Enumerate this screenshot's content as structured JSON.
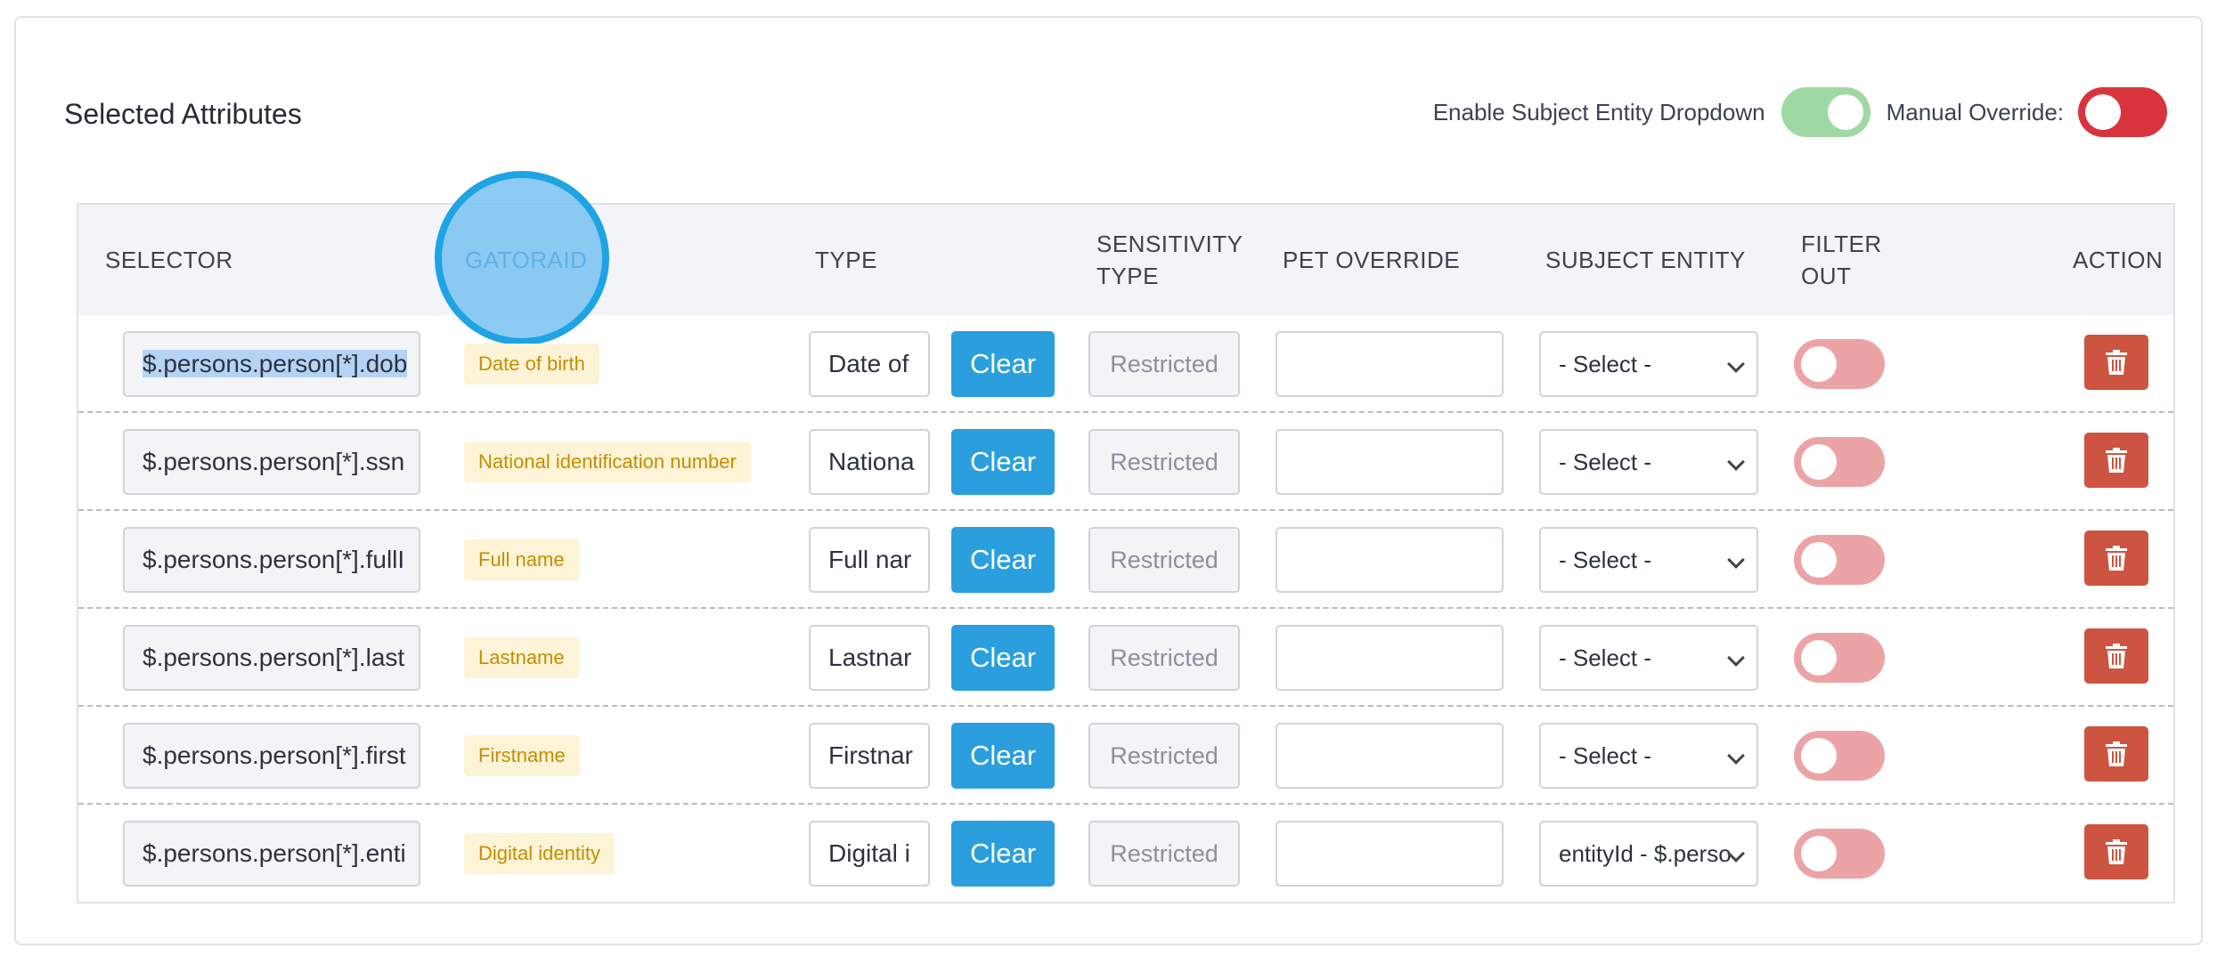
{
  "card": {
    "title": "Selected Attributes",
    "enable_subject_entity_label": "Enable Subject Entity Dropdown",
    "enable_subject_entity_on": true,
    "manual_override_label": "Manual Override:",
    "manual_override_on": false
  },
  "table": {
    "headers": {
      "selector": "SELECTOR",
      "gatoraid": "GATORAID",
      "type": "TYPE",
      "sensitivity_line1": "SENSITIVITY",
      "sensitivity_line2": "TYPE",
      "pet_override": "PET OVERRIDE",
      "subject_entity": "SUBJECT ENTITY",
      "filter_line1": "FILTER",
      "filter_line2": "OUT",
      "action": "ACTION"
    },
    "rows": [
      {
        "selector": "$.persons.person[*].dob",
        "gatoraid": "Date of birth",
        "type": "Date of",
        "clear": "Clear",
        "sensitivity": "Restricted",
        "pet_override": "",
        "subject_entity": "- Select -",
        "filter_out": false
      },
      {
        "selector": "$.persons.person[*].ssn",
        "gatoraid": "National identification number",
        "type": "Nationa",
        "clear": "Clear",
        "sensitivity": "Restricted",
        "pet_override": "",
        "subject_entity": "- Select -",
        "filter_out": false
      },
      {
        "selector": "$.persons.person[*].fullI",
        "gatoraid": "Full name",
        "type": "Full nar",
        "clear": "Clear",
        "sensitivity": "Restricted",
        "pet_override": "",
        "subject_entity": "- Select -",
        "filter_out": false
      },
      {
        "selector": "$.persons.person[*].last",
        "gatoraid": "Lastname",
        "type": "Lastnar",
        "clear": "Clear",
        "sensitivity": "Restricted",
        "pet_override": "",
        "subject_entity": "- Select -",
        "filter_out": false
      },
      {
        "selector": "$.persons.person[*].first",
        "gatoraid": "Firstname",
        "type": "Firstnar",
        "clear": "Clear",
        "sensitivity": "Restricted",
        "pet_override": "",
        "subject_entity": "- Select -",
        "filter_out": false
      },
      {
        "selector": "$.persons.person[*].enti",
        "gatoraid": "Digital identity",
        "type": "Digital i",
        "clear": "Clear",
        "sensitivity": "Restricted",
        "pet_override": "",
        "subject_entity": "entityId - $.perso",
        "filter_out": false
      }
    ]
  },
  "icons": {
    "delete": "trash-icon",
    "dropdown": "chevron-down-icon"
  },
  "colors": {
    "clear_button": "#2b9fdd",
    "delete_button": "#cd5440",
    "toggle_on_green": "#9fd8a2",
    "toggle_red": "#d9343e",
    "badge_bg": "#fdf3d6",
    "badge_text": "#c38f00"
  }
}
